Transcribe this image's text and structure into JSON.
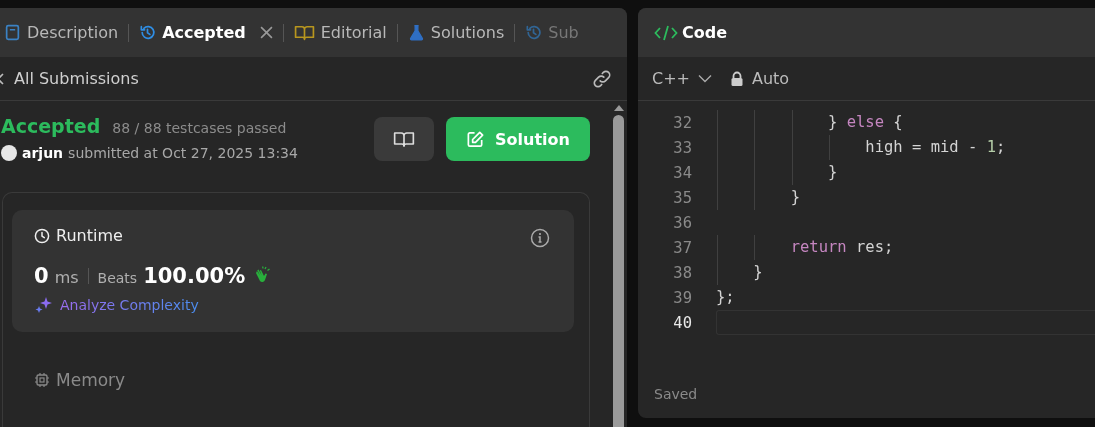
{
  "left_panel": {
    "tabs": [
      {
        "label": "Description",
        "selected": false,
        "kind": "description",
        "closable": false
      },
      {
        "label": "Accepted",
        "selected": true,
        "kind": "history",
        "closable": true
      },
      {
        "label": "Editorial",
        "selected": false,
        "kind": "editorial",
        "closable": false
      },
      {
        "label": "Solutions",
        "selected": false,
        "kind": "solutions",
        "closable": false
      },
      {
        "label": "Sub",
        "selected": false,
        "kind": "history",
        "closable": false
      }
    ],
    "subheader": {
      "title": "All Submissions"
    },
    "submission": {
      "status": "Accepted",
      "testcases": "88 / 88 testcases passed",
      "user": "arjun",
      "submitted": "submitted at Oct 27, 2025 13:34",
      "solution_button": "Solution"
    },
    "runtime": {
      "title": "Runtime",
      "value": "0",
      "unit": "ms",
      "beats_label": "Beats",
      "beats": "100.00%",
      "analyze": "Analyze Complexity"
    },
    "memory": {
      "title": "Memory"
    }
  },
  "code_panel": {
    "title": "Code",
    "language": "C++",
    "mode": "Auto",
    "lines": [
      {
        "number": "32",
        "current": false,
        "tokens": [
          {
            "text": "            } ",
            "kind": "plain"
          },
          {
            "text": "else",
            "kind": "keyword"
          },
          {
            "text": " {",
            "kind": "plain"
          }
        ]
      },
      {
        "number": "33",
        "current": false,
        "tokens": [
          {
            "text": "                high = mid - ",
            "kind": "plain"
          },
          {
            "text": "1",
            "kind": "number"
          },
          {
            "text": ";",
            "kind": "plain"
          }
        ]
      },
      {
        "number": "34",
        "current": false,
        "tokens": [
          {
            "text": "            }",
            "kind": "plain"
          }
        ]
      },
      {
        "number": "35",
        "current": false,
        "tokens": [
          {
            "text": "        }",
            "kind": "plain"
          }
        ]
      },
      {
        "number": "36",
        "current": false
      },
      {
        "number": "37",
        "current": false,
        "tokens": [
          {
            "text": "        return",
            "kind": "keyword"
          },
          {
            "text": " res;",
            "kind": "plain"
          }
        ]
      },
      {
        "number": "38",
        "current": false,
        "tokens": [
          {
            "text": "    }",
            "kind": "plain"
          }
        ]
      },
      {
        "number": "39",
        "current": false,
        "tokens": [
          {
            "text": "};",
            "kind": "plain"
          }
        ]
      },
      {
        "number": "40",
        "current": true
      }
    ],
    "status": "Saved"
  }
}
